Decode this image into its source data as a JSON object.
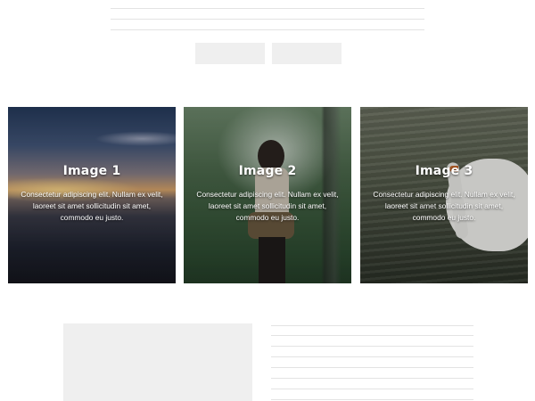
{
  "gallery": {
    "cards": [
      {
        "title": "Image 1",
        "description": "Consectetur adipiscing elit. Nullam ex velit, laoreet sit amet sollicitudin sit amet, commodo eu justo.",
        "scene": "ocean at sunset"
      },
      {
        "title": "Image 2",
        "description": "Consectetur adipiscing elit. Nullam ex velit, laoreet sit amet sollicitudin sit amet, commodo eu justo.",
        "scene": "hiker in forest"
      },
      {
        "title": "Image 3",
        "description": "Consectetur adipiscing elit. Nullam ex velit, laoreet sit amet sollicitudin sit amet, commodo eu justo.",
        "scene": "swan on water"
      }
    ]
  },
  "colors": {
    "placeholder": "#efefef",
    "line": "#e3e3e3",
    "caption_text": "#ffffff"
  }
}
